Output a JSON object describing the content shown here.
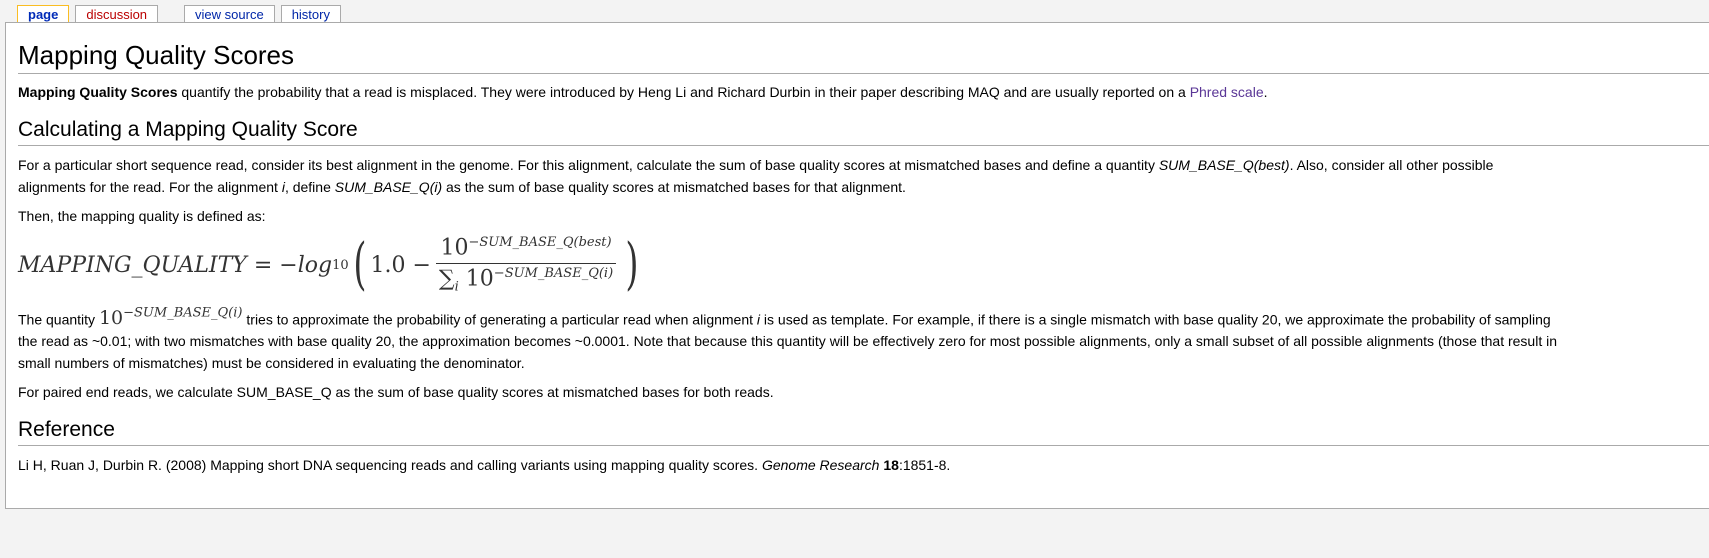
{
  "tabs": [
    {
      "label": "page",
      "active": true
    },
    {
      "label": "discussion"
    },
    {
      "label": "view source"
    },
    {
      "label": "history"
    }
  ],
  "title": "Mapping Quality Scores",
  "intro": {
    "bold": "Mapping Quality Scores",
    "text": " quantify the probability that a read is misplaced. They were introduced by Heng Li and Richard Durbin in their paper describing MAQ and are usually reported on a ",
    "link": "Phred scale",
    "end": "."
  },
  "section1": {
    "heading": "Calculating a Mapping Quality Score",
    "p1": {
      "a": "For a particular short sequence read, consider its best alignment in the genome. For this alignment, calculate the sum of base quality scores at mismatched bases and define a quantity ",
      "b": "SUM_BASE_Q(best)",
      "c": ". Also, consider all other possible alignments for the read. For the alignment ",
      "d": "i",
      "e": ", define ",
      "f": "SUM_BASE_Q(i)",
      "g": " as the sum of base quality scores at mismatched bases for that alignment."
    },
    "p2": "Then, the mapping quality is defined as:",
    "formula": {
      "lhs": "MAPPING_QUALITY",
      "eq": "= −",
      "log": "log",
      "log_sub": "10",
      "one": "1.0 −",
      "num_base": "10",
      "num_exp": "−SUM_BASE_Q(best)",
      "den_sum": "∑",
      "den_sub": "i",
      "den_base": "10",
      "den_exp": "−SUM_BASE_Q(i)"
    },
    "p3": {
      "a": "The quantity ",
      "fbase": "10",
      "fexp": "−SUM_BASE_Q(i)",
      "b": " tries to approximate the probability of generating a particular read when alignment ",
      "c": "i",
      "d": " is used as template. For example, if there is a single mismatch with base quality 20, we approximate the probability of sampling the read as ~0.01; with two mismatches with base quality 20, the approximation becomes ~0.0001. Note that because this quantity will be effectively zero for most possible alignments, only a small subset of all possible alignments (those that result in small numbers of mismatches) must be considered in evaluating the denominator."
    },
    "p4": "For paired end reads, we calculate SUM_BASE_Q as the sum of base quality scores at mismatched bases for both reads."
  },
  "reference": {
    "heading": "Reference",
    "a": "Li H, Ruan J, Durbin R. (2008) Mapping short DNA sequencing reads and calling variants using mapping quality scores. ",
    "journal": "Genome Research",
    "sp": " ",
    "vol": "18",
    "pages": ":1851-8."
  }
}
